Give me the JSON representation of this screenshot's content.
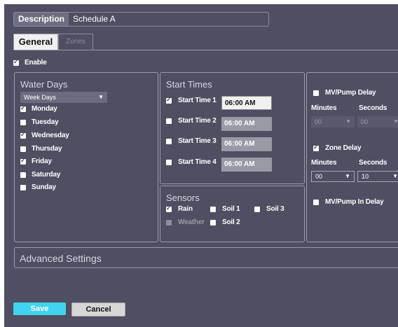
{
  "description": {
    "label": "Description",
    "value": "Schedule A"
  },
  "tabs": {
    "general": "General",
    "zones": "Zones"
  },
  "enable": {
    "label": "Enable",
    "checked": true
  },
  "water_days": {
    "title": "Water Days",
    "select": "Week Days",
    "days": [
      {
        "label": "Monday",
        "checked": true
      },
      {
        "label": "Tuesday",
        "checked": false
      },
      {
        "label": "Wednesday",
        "checked": true
      },
      {
        "label": "Thursday",
        "checked": false
      },
      {
        "label": "Friday",
        "checked": true
      },
      {
        "label": "Saturday",
        "checked": false
      },
      {
        "label": "Sunday",
        "checked": false
      }
    ]
  },
  "start_times": {
    "title": "Start Times",
    "items": [
      {
        "label": "Start Time 1",
        "value": "06:00 AM",
        "checked": true
      },
      {
        "label": "Start Time 2",
        "value": "06:00 AM",
        "checked": false
      },
      {
        "label": "Start Time 3",
        "value": "06:00 AM",
        "checked": false
      },
      {
        "label": "Start Time 4",
        "value": "06:00 AM",
        "checked": false
      }
    ]
  },
  "sensors": {
    "title": "Sensors",
    "rain": "Rain",
    "soil1": "Soil 1",
    "soil3": "Soil 3",
    "weather": "Weather",
    "soil2": "Soil 2"
  },
  "pump": {
    "mv_delay": "MV/Pump Delay",
    "minutes": "Minutes",
    "seconds": "Seconds",
    "mv_minutes": "00",
    "mv_seconds": "00",
    "zone_delay": "Zone Delay",
    "zone_minutes": "00",
    "zone_seconds": "10",
    "mv_in_delay": "MV/Pump In Delay"
  },
  "advanced": "Advanced Settings",
  "buttons": {
    "save": "Save",
    "cancel": "Cancel"
  }
}
